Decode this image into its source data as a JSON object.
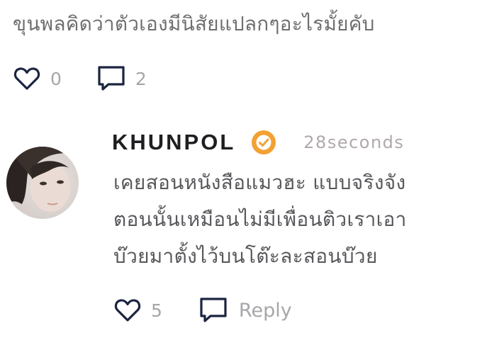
{
  "parent_comment": {
    "text": "ขุนพลคิดว่าตัวเองมีนิสัยแปลกๆอะไรมั้ยคับ",
    "like_icon": "heart-outline-icon",
    "like_count": "0",
    "comment_icon": "speech-bubble-icon",
    "comment_count": "2"
  },
  "reply": {
    "avatar": "user-avatar-photo",
    "username": "KHUNPOL",
    "verified_icon": "verified-badge-icon",
    "timestamp": "28seconds",
    "lines": [
      "เคยสอนหนังสือแมวฮะ แบบจริงจัง",
      "ตอนนั้นเหมือนไม่มีเพื่อนติวเราเอา",
      "บ๊วยมาตั้งไว้บนโต๊ะละสอนบ๊วย"
    ],
    "like_icon": "heart-outline-icon",
    "like_count": "5",
    "reply_icon": "speech-bubble-icon",
    "reply_label": "Reply"
  },
  "colors": {
    "text_gray": "#6f6f72",
    "icon_navy": "#1b2540",
    "count_gray": "#a7a7aa",
    "username": "#1f1f22",
    "timestamp": "#b1a9a9",
    "badge_orange": "#f3a133"
  }
}
